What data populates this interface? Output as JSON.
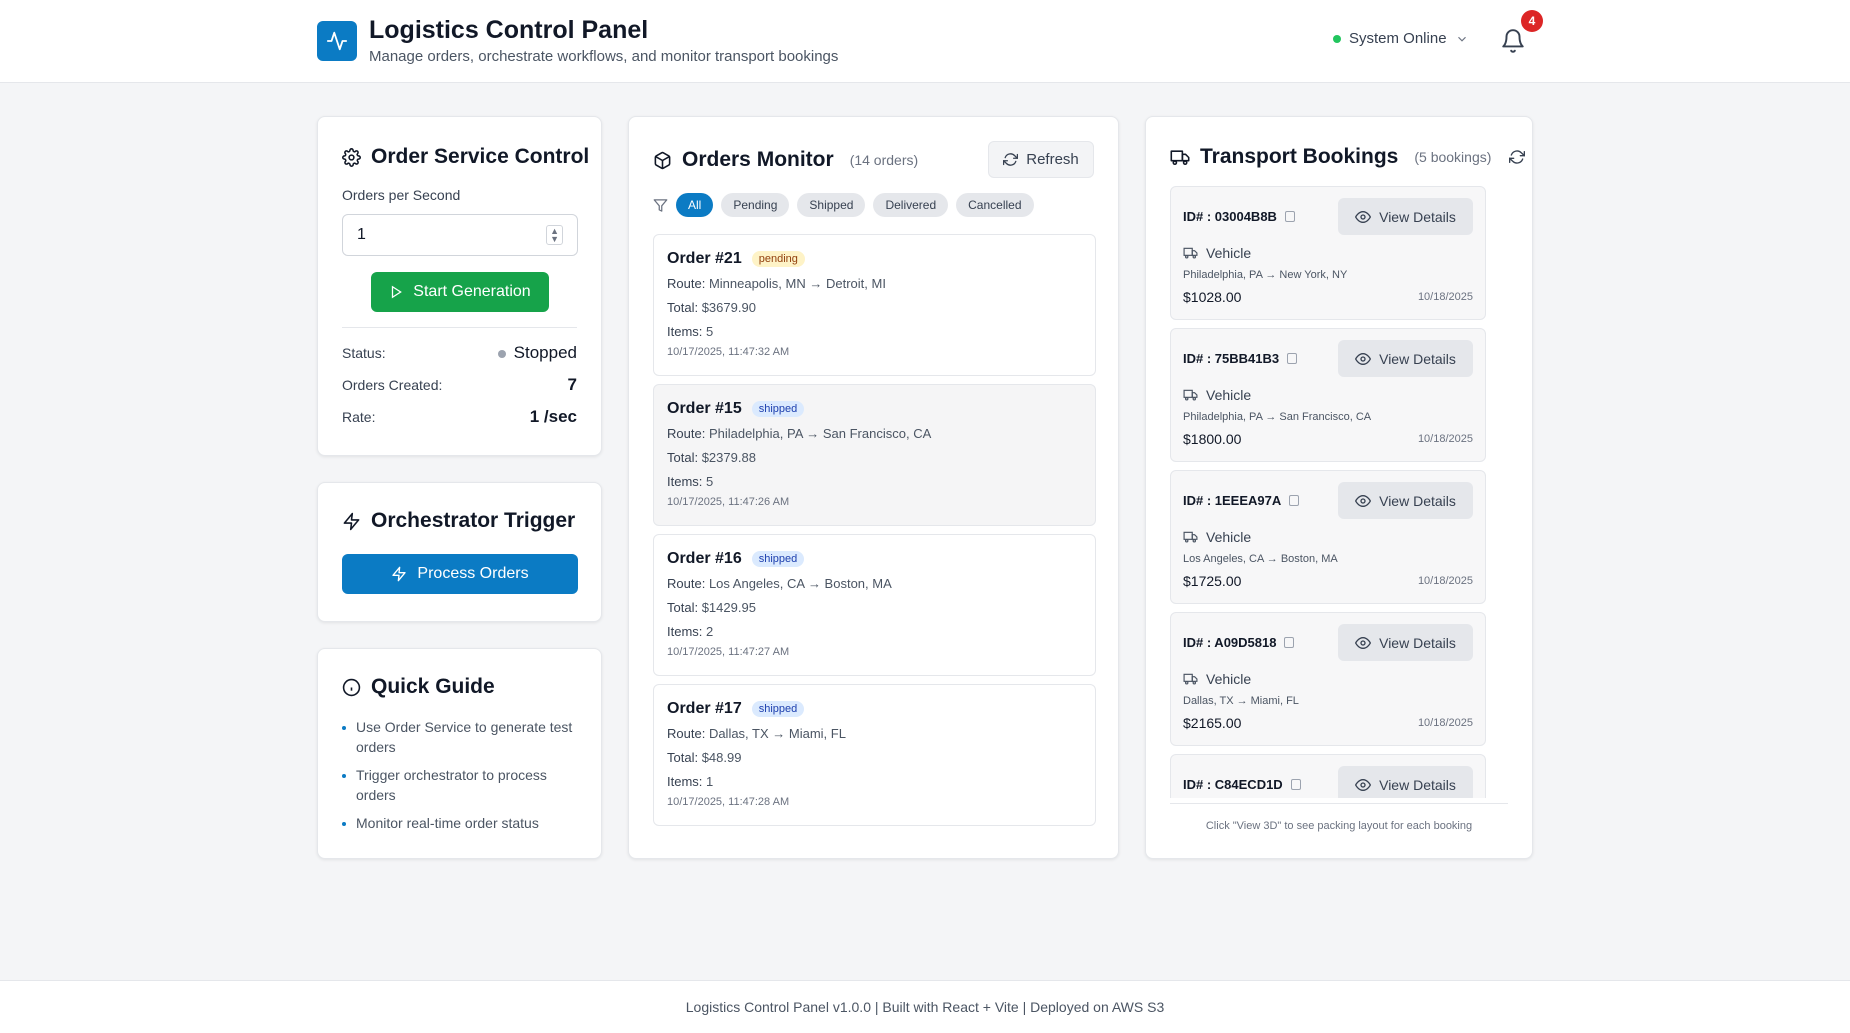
{
  "header": {
    "title": "Logistics Control Panel",
    "subtitle": "Manage orders, orchestrate workflows, and monitor transport bookings",
    "system_status": "System Online",
    "notification_count": "4"
  },
  "order_service": {
    "title": "Order Service Control",
    "rate_label": "Orders per Second",
    "rate_value": "1",
    "start_button": "Start Generation",
    "status_label": "Status:",
    "status_value": "Stopped",
    "created_label": "Orders Created:",
    "created_value": "7",
    "rate_stat_label": "Rate:",
    "rate_stat_value": "1 /sec"
  },
  "orchestrator": {
    "title": "Orchestrator Trigger",
    "process_button": "Process Orders"
  },
  "guide": {
    "title": "Quick Guide",
    "items": [
      "Use Order Service to generate test orders",
      "Trigger orchestrator to process orders",
      "Monitor real-time order status"
    ]
  },
  "orders_monitor": {
    "title": "Orders Monitor",
    "count": "(14 orders)",
    "refresh": "Refresh",
    "filters": [
      "All",
      "Pending",
      "Shipped",
      "Delivered",
      "Cancelled"
    ],
    "orders": [
      {
        "title": "Order #21",
        "status": "pending",
        "route_label": "Route:",
        "route": "Minneapolis, MN → Detroit, MI",
        "total_label": "Total:",
        "total": "$3679.90",
        "items_label": "Items:",
        "items": "5",
        "time": "10/17/2025, 11:47:32 AM"
      },
      {
        "title": "Order #15",
        "status": "shipped",
        "route_label": "Route:",
        "route": "Philadelphia, PA → San Francisco, CA",
        "total_label": "Total:",
        "total": "$2379.88",
        "items_label": "Items:",
        "items": "5",
        "time": "10/17/2025, 11:47:26 AM"
      },
      {
        "title": "Order #16",
        "status": "shipped",
        "route_label": "Route:",
        "route": "Los Angeles, CA → Boston, MA",
        "total_label": "Total:",
        "total": "$1429.95",
        "items_label": "Items:",
        "items": "2",
        "time": "10/17/2025, 11:47:27 AM"
      },
      {
        "title": "Order #17",
        "status": "shipped",
        "route_label": "Route:",
        "route": "Dallas, TX → Miami, FL",
        "total_label": "Total:",
        "total": "$48.99",
        "items_label": "Items:",
        "items": "1",
        "time": "10/17/2025, 11:47:28 AM"
      }
    ]
  },
  "transport": {
    "title": "Transport Bookings",
    "count": "(5 bookings)",
    "view_label": "View Details",
    "type": "Vehicle",
    "bookings": [
      {
        "id": "ID# : 03004B8B",
        "route": "Philadelphia, PA → New York, NY",
        "price": "$1028.00",
        "date": "10/18/2025"
      },
      {
        "id": "ID# : 75BB41B3",
        "route": "Philadelphia, PA → San Francisco, CA",
        "price": "$1800.00",
        "date": "10/18/2025"
      },
      {
        "id": "ID# : 1EEEA97A",
        "route": "Los Angeles, CA → Boston, MA",
        "price": "$1725.00",
        "date": "10/18/2025"
      },
      {
        "id": "ID# : A09D5818",
        "route": "Dallas, TX → Miami, FL",
        "price": "$2165.00",
        "date": "10/18/2025"
      },
      {
        "id": "ID# : C84ECD1D",
        "route": "",
        "price": "",
        "date": ""
      }
    ],
    "footer_note": "Click \"View 3D\" to see packing layout for each booking"
  },
  "footer": {
    "text": "Logistics Control Panel v1.0.0 | Built with React + Vite | Deployed on AWS S3"
  },
  "colors": {
    "primary": "#0b7bc4",
    "success": "#16a34a",
    "danger": "#dc2626"
  }
}
